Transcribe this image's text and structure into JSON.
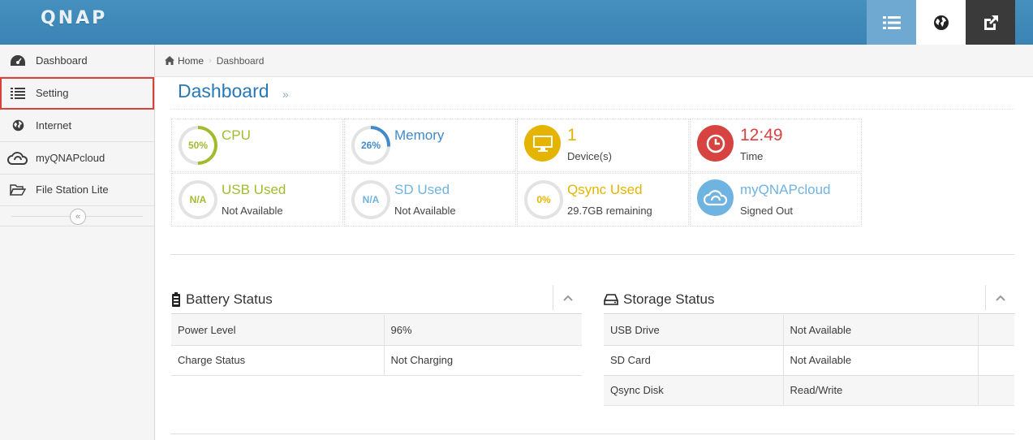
{
  "header": {
    "logo": "QNAP",
    "buttons": [
      "list-icon",
      "globe-icon",
      "external-link-icon"
    ],
    "colors": {
      "bar": "#3a86b8",
      "menu_btn": "#6fa8d0",
      "ext_btn": "#3a3a3a"
    }
  },
  "sidebar": {
    "items": [
      {
        "label": "Dashboard",
        "icon": "dashboard-icon"
      },
      {
        "label": "Setting",
        "icon": "list-icon",
        "highlighted": true
      },
      {
        "label": "Internet",
        "icon": "globe-icon"
      },
      {
        "label": "myQNAPcloud",
        "icon": "cloud-icon"
      },
      {
        "label": "File Station Lite",
        "icon": "folder-open-icon"
      }
    ],
    "collapse_glyph": "«"
  },
  "breadcrumb": {
    "home": "Home",
    "current": "Dashboard"
  },
  "page": {
    "title": "Dashboard",
    "title_arrow": "»"
  },
  "stats": {
    "cpu": {
      "value": "50%",
      "label": "CPU",
      "percent": 50,
      "color": "#a0bc2e"
    },
    "memory": {
      "value": "26%",
      "label": "Memory",
      "percent": 26,
      "color": "#428bca"
    },
    "devices": {
      "value": "1",
      "label": "Device(s)",
      "color": "#e4b400"
    },
    "time": {
      "value": "12:49",
      "label": "Time",
      "color": "#d64340"
    },
    "usb": {
      "value": "N/A",
      "label": "USB Used",
      "status": "Not Available",
      "color": "#a0bc2e"
    },
    "sd": {
      "value": "N/A",
      "label": "SD Used",
      "status": "Not Available",
      "color": "#6fb3e0"
    },
    "qsync": {
      "value": "0%",
      "label": "Qsync Used",
      "status": "29.7GB remaining",
      "color": "#e4b400"
    },
    "myqnapcloud": {
      "label": "myQNAPcloud",
      "status": "Signed Out",
      "color": "#6fb3e0"
    }
  },
  "battery": {
    "title": "Battery Status",
    "rows": [
      {
        "k": "Power Level",
        "v": "96%"
      },
      {
        "k": "Charge Status",
        "v": "Not Charging"
      }
    ]
  },
  "storage": {
    "title": "Storage Status",
    "rows": [
      {
        "k": "USB Drive",
        "v": "Not Available"
      },
      {
        "k": "SD Card",
        "v": "Not Available"
      },
      {
        "k": "Qsync Disk",
        "v": "Read/Write"
      }
    ]
  }
}
